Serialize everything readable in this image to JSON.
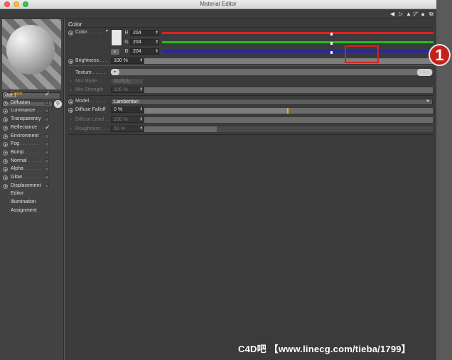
{
  "window": {
    "title": "Material Editor"
  },
  "material": {
    "name": "Mat.1"
  },
  "channels": [
    {
      "label": "Color",
      "active": true,
      "checked": true
    },
    {
      "label": "Diffusion",
      "active": false,
      "checked": false
    },
    {
      "label": "Luminance",
      "active": false,
      "checked": false
    },
    {
      "label": "Transparency",
      "active": false,
      "checked": false
    },
    {
      "label": "Reflectance",
      "active": false,
      "checked": true
    },
    {
      "label": "Environment",
      "active": false,
      "checked": false
    },
    {
      "label": "Fog",
      "active": false,
      "checked": false
    },
    {
      "label": "Bump",
      "active": false,
      "checked": false
    },
    {
      "label": "Normal",
      "active": false,
      "checked": false
    },
    {
      "label": "Alpha",
      "active": false,
      "checked": false
    },
    {
      "label": "Glow",
      "active": false,
      "checked": false
    },
    {
      "label": "Displacement",
      "active": false,
      "checked": false
    }
  ],
  "extra_links": [
    "Editor",
    "Illumination",
    "Assignment"
  ],
  "color_section": {
    "title": "Color",
    "color_label": "Color",
    "r_label": "R",
    "r_value": "204",
    "g_label": "G",
    "g_value": "204",
    "b_label": "B",
    "b_value": "204",
    "brightness_label": "Brightness",
    "brightness_value": "100 %",
    "texture_label": "Texture",
    "texture_button": "...",
    "mix_mode_label": "Mix Mode",
    "mix_mode_value": "Multiply",
    "mix_strength_label": "Mix Strength",
    "mix_strength_value": "100 %"
  },
  "shading": {
    "model_label": "Model",
    "model_value": "Lambertian",
    "diffuse_falloff_label": "Diffuse Falloff",
    "diffuse_falloff_value": "0 %",
    "diffuse_level_label": "Diffuse Level",
    "diffuse_level_value": "100 %",
    "roughness_label": "Roughness",
    "roughness_value": "50 %"
  },
  "levels": {
    "r": 0.62,
    "g": 0.62,
    "b": 0.62,
    "brightness": 1.0,
    "mix_strength": 1.0,
    "diffuse_falloff": 0.5,
    "diffuse_level": 1.0,
    "roughness": 0.25
  },
  "colors": {
    "accent": "#f0b400",
    "red_slider": "#e02020",
    "green_slider": "#20c020",
    "blue_slider": "#2020d0",
    "annotation": "#d12424"
  },
  "annotation": {
    "number": "1"
  },
  "watermark": {
    "text": "C4D吧 【www.linecg.com/tieba/1799】"
  }
}
